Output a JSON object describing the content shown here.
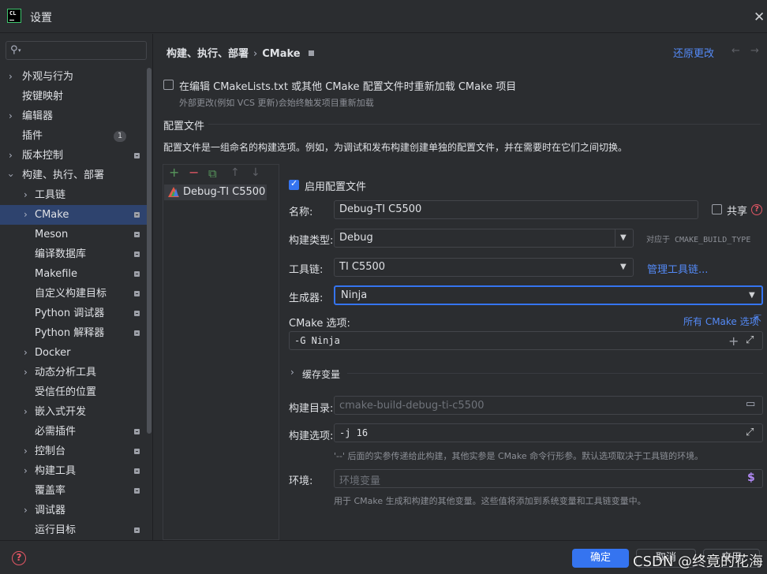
{
  "window": {
    "title": "设置",
    "logo_text": "CL"
  },
  "sidebar": {
    "search_placeholder": "",
    "items": [
      {
        "label": "外观与行为"
      },
      {
        "label": "按键映射"
      },
      {
        "label": "编辑器"
      },
      {
        "label": "插件",
        "badge": "1"
      },
      {
        "label": "版本控制"
      },
      {
        "label": "构建、执行、部署"
      },
      {
        "label": "工具链"
      },
      {
        "label": "CMake"
      },
      {
        "label": "Meson"
      },
      {
        "label": "编译数据库"
      },
      {
        "label": "Makefile"
      },
      {
        "label": "自定义构建目标"
      },
      {
        "label": "Python 调试器"
      },
      {
        "label": "Python 解释器"
      },
      {
        "label": "Docker"
      },
      {
        "label": "动态分析工具"
      },
      {
        "label": "受信任的位置"
      },
      {
        "label": "嵌入式开发"
      },
      {
        "label": "必需插件"
      },
      {
        "label": "控制台"
      },
      {
        "label": "构建工具"
      },
      {
        "label": "覆盖率"
      },
      {
        "label": "调试器"
      },
      {
        "label": "运行目标"
      }
    ]
  },
  "header": {
    "crumb_parent": "构建、执行、部署",
    "crumb_sep": "›",
    "crumb_current": "CMake",
    "reset_label": "还原更改",
    "back_arrow": "←",
    "forward_arrow": "→"
  },
  "reload": {
    "label": "在编辑 CMakeLists.txt 或其他 CMake 配置文件时重新加载 CMake 项目",
    "hint": "外部更改(例如 VCS 更新)会始终触发项目重新加载"
  },
  "profiles": {
    "section_title": "配置文件",
    "description": "配置文件是一组命名的构建选项。例如，为调试和发布构建创建单独的配置文件，并在需要时在它们之间切换。",
    "toolbar": {
      "add": "+",
      "remove": "−",
      "copy": "⧉",
      "up": "↑",
      "down": "↓"
    },
    "list": [
      "Debug-TI C5500"
    ]
  },
  "form": {
    "enable_label": "启用配置文件",
    "name_label": "名称:",
    "name_value": "Debug-TI C5500",
    "share_label": "共享",
    "help_glyph": "?",
    "build_type_label": "构建类型:",
    "build_type_value": "Debug",
    "build_type_note": "对应于 CMAKE_BUILD_TYPE",
    "toolchain_label": "工具链:",
    "toolchain_value": "TI C5500",
    "manage_toolchains": "管理工具链...",
    "generator_label": "生成器:",
    "generator_value": "Ninja",
    "cmake_options_label": "CMake 选项:",
    "all_cmake_options": "所有 CMake 选项",
    "cmake_options_value": "-G Ninja",
    "cache_vars_label": "缓存变量",
    "build_dir_label": "构建目录:",
    "build_dir_value": "cmake-build-debug-ti-c5500",
    "build_options_label": "构建选项:",
    "build_options_value": "-j 16",
    "build_options_hint": "'--' 后面的实参传递给此构建，其他实参是 CMake 命令行形参。默认选项取决于工具链的环境。",
    "env_label": "环境:",
    "env_placeholder": "环境变量",
    "env_hint": "用于 CMake 生成和构建的其他变量。这些值将添加到系统变量和工具链变量中。"
  },
  "buttons": {
    "ok": "确定",
    "cancel": "取消",
    "apply": "应用",
    "help": "?"
  },
  "watermark": "CSDN @终竟的花海"
}
